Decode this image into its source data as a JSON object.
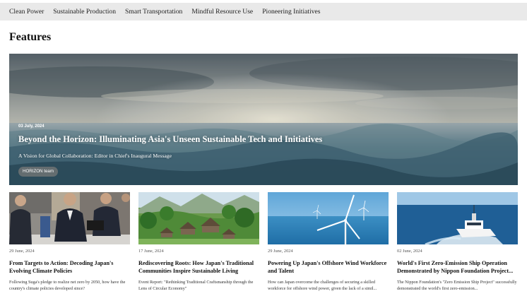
{
  "nav": {
    "items": [
      "Clean Power",
      "Sustainable Production",
      "Smart Transportation",
      "Mindful Resource Use",
      "Pioneering Initiatives"
    ]
  },
  "page": {
    "title": "Features"
  },
  "hero": {
    "date": "03 July, 2024",
    "title": "Beyond the Horizon: Illuminating Asia's Unseen Sustainable Tech and Initiatives",
    "subtitle": "A Vision for Global Collaboration: Editor in Chief's Inaugural Message",
    "tag": "HORIZON team"
  },
  "cards": [
    {
      "date": "29 June, 2024",
      "title": "From Targets to Action: Decoding Japan's Evolving Climate Policies",
      "excerpt": "Following Suga's pledge to realize net zero by 2050, how have the country's climate policies developed since?"
    },
    {
      "date": "17 June, 2024",
      "title": "Rediscovering Roots: How Japan's Traditional Communities Inspire Sustainable Living",
      "excerpt": "Event Report: \"Rethinking Traditional Craftsmanship through the Lens of Circular Economy\""
    },
    {
      "date": "29 June, 2024",
      "title": "Powering Up Japan's Offshore Wind Workforce and Talent",
      "excerpt": "How can Japan overcome the challenges of securing a skilled workforce for offshore wind power, given the lack of a simil..."
    },
    {
      "date": "02 June, 2024",
      "title": "World's First Zero-Emission Ship Operation Demonstrated by Nippon Foundation Project...",
      "excerpt": "The Nippon Foundation's \"Zero Emission Ship Project\" successfully demonstrated the world's first zero-emission..."
    }
  ]
}
